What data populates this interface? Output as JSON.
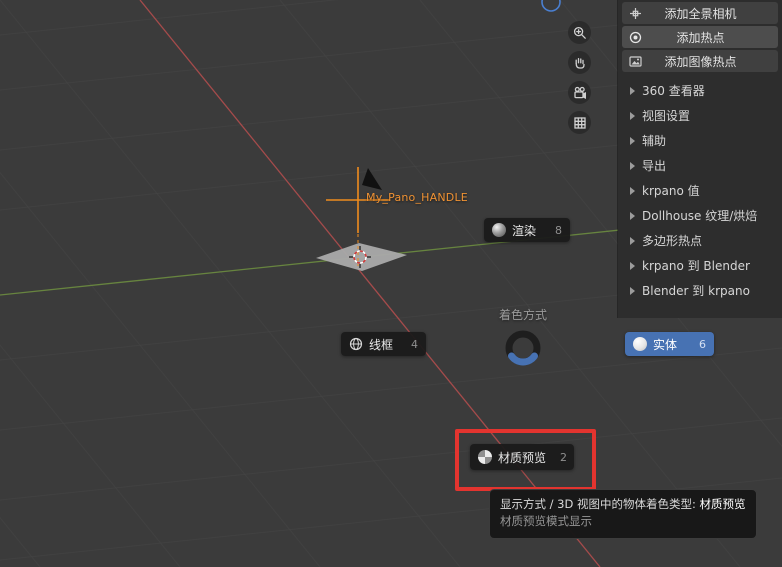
{
  "colors": {
    "accent_blue": "#4772b3",
    "annotation_red": "#e3342f",
    "object_orange": "#f09233",
    "axis_x_red": "#b14d4d",
    "axis_y_green": "#6f9140",
    "viewport_bg": "#3b3b3b",
    "panel_bg": "#2d2d2d"
  },
  "viewport": {
    "object_label": "My_Pano_HANDLE",
    "nav_buttons": [
      {
        "icon": "zoom-in-icon"
      },
      {
        "icon": "pan-hand-icon"
      },
      {
        "icon": "camera-view-icon"
      },
      {
        "icon": "grid-ortho-icon"
      }
    ]
  },
  "pie_menu": {
    "title": "着色方式",
    "items": [
      {
        "label": "渲染",
        "shortcut": "8",
        "icon": "rendered-sphere-icon",
        "selected": false
      },
      {
        "label": "线框",
        "shortcut": "4",
        "icon": "wireframe-sphere-icon",
        "selected": false
      },
      {
        "label": "实体",
        "shortcut": "6",
        "icon": "solid-sphere-icon",
        "selected": true
      },
      {
        "label": "材质预览",
        "shortcut": "2",
        "icon": "material-sphere-icon",
        "selected": false,
        "annotated": true
      }
    ]
  },
  "sidebar": {
    "buttons": [
      {
        "label": "添加全景相机",
        "icon": "pano-camera-icon",
        "active": false
      },
      {
        "label": "添加热点",
        "icon": "hotspot-icon",
        "active": true
      },
      {
        "label": "添加图像热点",
        "icon": "image-hotspot-icon",
        "active": false
      }
    ],
    "sections": [
      {
        "label": "360 查看器"
      },
      {
        "label": "视图设置"
      },
      {
        "label": "辅助"
      },
      {
        "label": "导出"
      },
      {
        "label": "krpano 值"
      },
      {
        "label": "Dollhouse 纹理/烘焙"
      },
      {
        "label": "多边形热点"
      },
      {
        "label": "krpano 到 Blender"
      },
      {
        "label": "Blender 到 krpano"
      }
    ]
  },
  "tooltip": {
    "line1_label": "显示方式 / 3D 视图中的物体着色类型:",
    "line1_value": "材质预览",
    "line2": "材质预览模式显示"
  }
}
